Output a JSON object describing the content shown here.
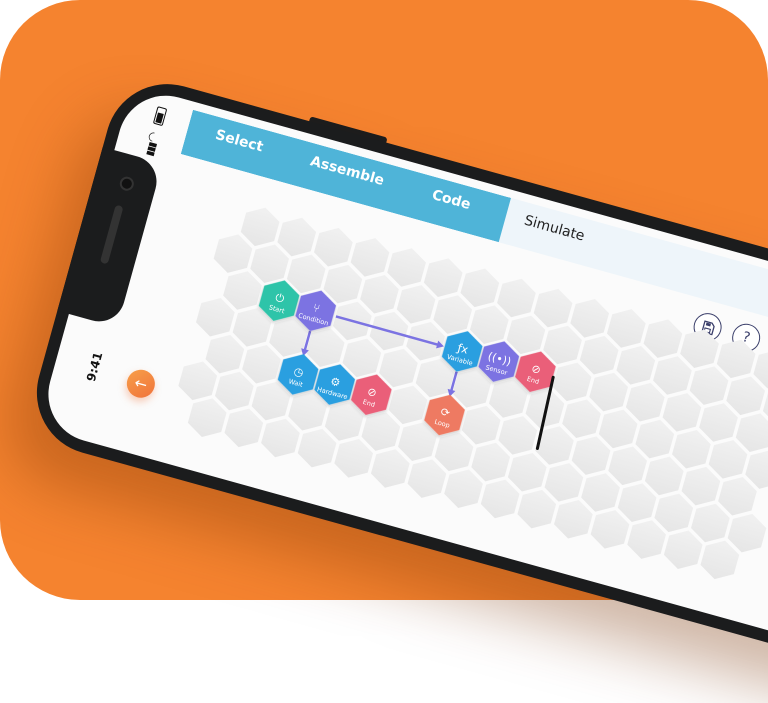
{
  "status_bar": {
    "time": "9:41"
  },
  "tabs": [
    {
      "label": "Select",
      "state": "done"
    },
    {
      "label": "Assemble",
      "state": "done"
    },
    {
      "label": "Code",
      "state": "done"
    },
    {
      "label": "Simulate",
      "state": "active"
    }
  ],
  "toolbar": {
    "save_icon": "save-icon",
    "help_label": "?"
  },
  "back_button": {
    "icon": "arrow-left-icon"
  },
  "blocks": [
    {
      "label": "Start",
      "icon": "power-icon",
      "color": "#2EC4A9"
    },
    {
      "label": "Condition",
      "icon": "branch-icon",
      "color": "#7B73E2"
    },
    {
      "label": "Wait",
      "icon": "timer-icon",
      "color": "#2A9FE0"
    },
    {
      "label": "Hardware",
      "icon": "gears-icon",
      "color": "#2A9FE0"
    },
    {
      "label": "End",
      "icon": "stop-icon",
      "color": "#EA5F79"
    },
    {
      "label": "Variable",
      "icon": "function-icon",
      "color": "#2A9FE0"
    },
    {
      "label": "Sensor",
      "icon": "signal-icon",
      "color": "#7B73E2"
    },
    {
      "label": "End",
      "icon": "stop-icon",
      "color": "#EA5F79"
    },
    {
      "label": "Loop",
      "icon": "loop-icon",
      "color": "#EE7A62"
    }
  ],
  "connections": [
    {
      "from": "Condition",
      "to": "Variable"
    },
    {
      "from": "Condition",
      "to": "Wait"
    },
    {
      "from": "Variable",
      "to": "Loop"
    }
  ],
  "colors": {
    "background": "#F5832F",
    "header": "#4FB4D8",
    "connector": "#7B73E2"
  }
}
